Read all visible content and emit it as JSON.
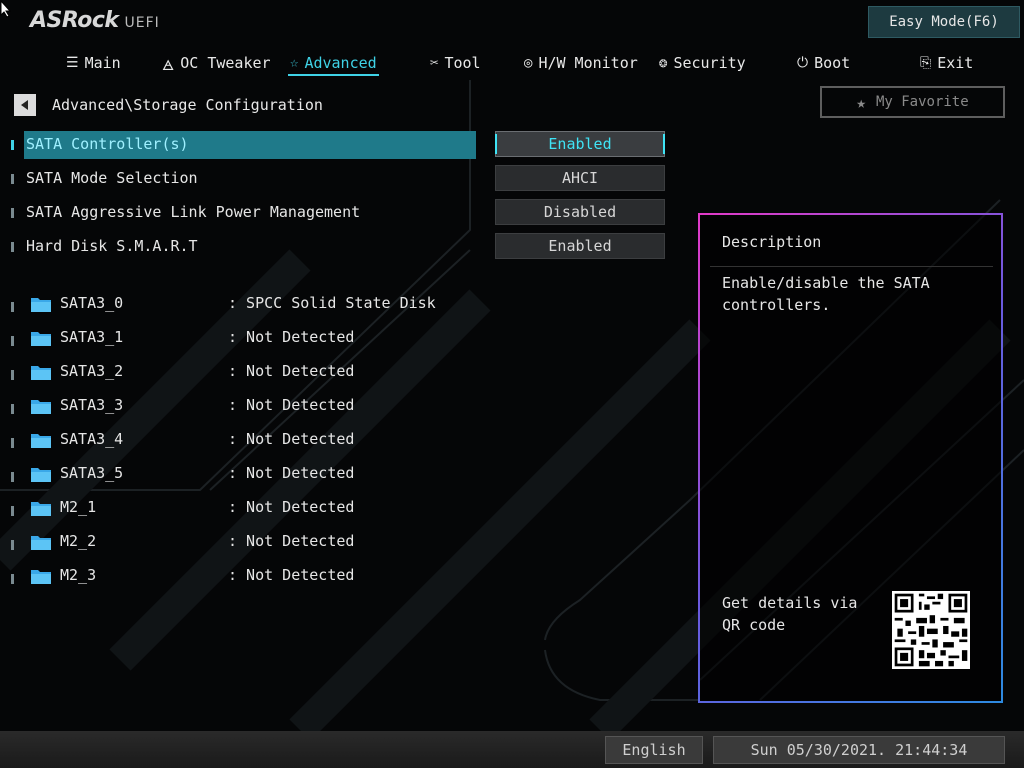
{
  "header": {
    "logo": "ASRock",
    "logo_sub": "UEFI",
    "easy_mode_label": "Easy Mode(F6)"
  },
  "tabs": [
    {
      "label": "Main",
      "icon": "list-icon"
    },
    {
      "label": "OC Tweaker",
      "icon": "rocket-icon"
    },
    {
      "label": "Advanced",
      "icon": "star-icon",
      "active": true
    },
    {
      "label": "Tool",
      "icon": "tools-icon"
    },
    {
      "label": "H/W Monitor",
      "icon": "monitor-icon"
    },
    {
      "label": "Security",
      "icon": "shield-icon"
    },
    {
      "label": "Boot",
      "icon": "power-icon"
    },
    {
      "label": "Exit",
      "icon": "exit-icon"
    }
  ],
  "breadcrumb": "Advanced\\Storage Configuration",
  "favorite_label": "My Favorite",
  "settings": [
    {
      "label": "SATA Controller(s)",
      "value": "Enabled",
      "selected": true
    },
    {
      "label": "SATA Mode Selection",
      "value": "AHCI"
    },
    {
      "label": "SATA Aggressive Link Power Management",
      "value": "Disabled"
    },
    {
      "label": "Hard Disk S.M.A.R.T",
      "value": "Enabled"
    }
  ],
  "devices": [
    {
      "name": "SATA3_0",
      "status": ": SPCC Solid State Disk"
    },
    {
      "name": "SATA3_1",
      "status": ": Not Detected"
    },
    {
      "name": "SATA3_2",
      "status": ": Not Detected"
    },
    {
      "name": "SATA3_3",
      "status": ": Not Detected"
    },
    {
      "name": "SATA3_4",
      "status": ": Not Detected"
    },
    {
      "name": "SATA3_5",
      "status": ": Not Detected"
    },
    {
      "name": "M2_1",
      "status": ": Not Detected"
    },
    {
      "name": "M2_2",
      "status": ": Not Detected"
    },
    {
      "name": "M2_3",
      "status": ": Not Detected"
    }
  ],
  "description": {
    "title": "Description",
    "text": "Enable/disable the SATA\ncontrollers.",
    "qr_text": "Get details via QR code"
  },
  "footer": {
    "language": "English",
    "datetime": "Sun 05/30/2021. 21:44:34"
  },
  "colors": {
    "accent": "#3fd2e6",
    "selected_row": "#1f7a8a",
    "background": "#050607"
  }
}
